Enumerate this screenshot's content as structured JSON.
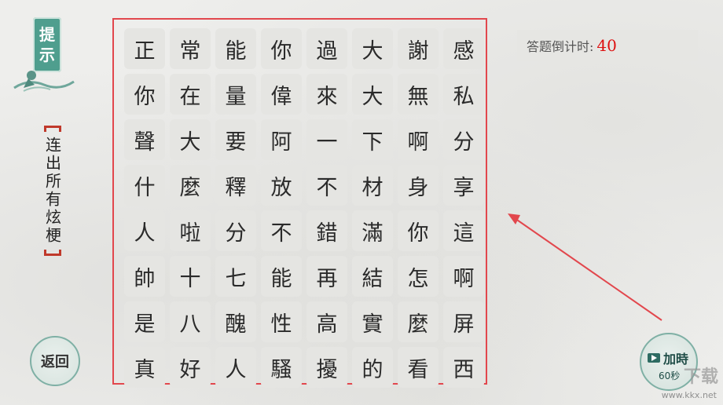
{
  "hint": {
    "label_1": "提",
    "label_2": "示"
  },
  "instruction": {
    "text": "连出所有炫梗"
  },
  "back_button": {
    "label": "返回"
  },
  "timer": {
    "label": "答题倒计时:",
    "value": "40"
  },
  "add_time_button": {
    "label": "加時",
    "sub": "60秒"
  },
  "watermark": {
    "text": "下载",
    "url": "www.kkx.net"
  },
  "colors": {
    "accent": "#e2474d",
    "timer_value": "#dd1111",
    "jade": "#4f9e8e"
  },
  "grid": [
    [
      "正",
      "常",
      "能",
      "你",
      "過",
      "大",
      "謝",
      "感"
    ],
    [
      "你",
      "在",
      "量",
      "偉",
      "來",
      "大",
      "無",
      "私"
    ],
    [
      "聲",
      "大",
      "要",
      "阿",
      "一",
      "下",
      "啊",
      "分"
    ],
    [
      "什",
      "麼",
      "釋",
      "放",
      "不",
      "材",
      "身",
      "享"
    ],
    [
      "人",
      "啦",
      "分",
      "不",
      "錯",
      "滿",
      "你",
      "這"
    ],
    [
      "帥",
      "十",
      "七",
      "能",
      "再",
      "結",
      "怎",
      "啊"
    ],
    [
      "是",
      "八",
      "醜",
      "性",
      "高",
      "實",
      "麼",
      "屏"
    ],
    [
      "真",
      "好",
      "人",
      "騷",
      "擾",
      "的",
      "看",
      "西"
    ]
  ]
}
